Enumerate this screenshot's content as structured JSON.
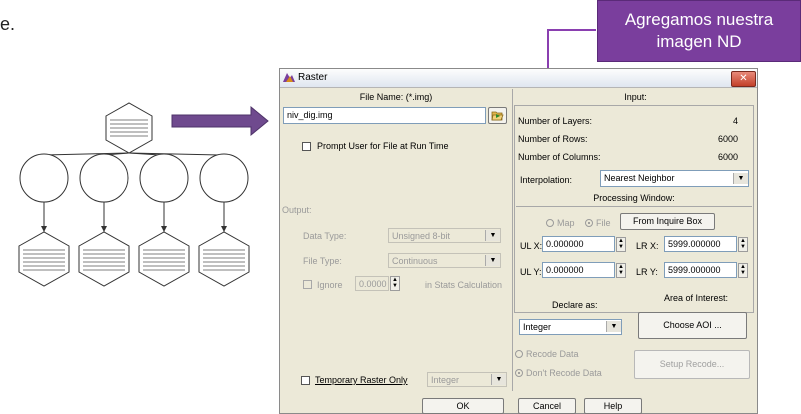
{
  "slide": {
    "fragment": "e.",
    "callout_line1": "Agregamos nuestra",
    "callout_line2": "imagen ND"
  },
  "colors": {
    "callout_purple": "#7a3e9d",
    "arrow_purple": "#6f4a8e",
    "connector_purple": "#8a3fb0",
    "dialog_bg": "#ece9d8",
    "close_red": "#c2402a"
  },
  "window": {
    "title": "Raster",
    "close_glyph": "✕"
  },
  "file": {
    "label": "File Name: (*.img)",
    "value": "niv_dig.img",
    "prompt_label": "Prompt User for File at Run Time"
  },
  "output": {
    "heading": "Output:",
    "data_type_label": "Data Type:",
    "data_type_value": "Unsigned 8-bit",
    "file_type_label": "File Type:",
    "file_type_value": "Continuous",
    "ignore_label": "Ignore",
    "ignore_value": "0.0000",
    "stats_label": "in Stats Calculation"
  },
  "input": {
    "heading": "Input:",
    "layers_label": "Number of Layers:",
    "layers_value": "4",
    "rows_label": "Number of Rows:",
    "rows_value": "6000",
    "cols_label": "Number of Columns:",
    "cols_value": "6000",
    "interp_label": "Interpolation:",
    "interp_value": "Nearest Neighbor"
  },
  "processing": {
    "heading": "Processing Window:",
    "map_label": "Map",
    "file_label": "File",
    "from_inquire": "From Inquire Box",
    "ulx_label": "UL X:",
    "ulx_value": "0.000000",
    "lrx_label": "LR X:",
    "lrx_value": "5999.000000",
    "uly_label": "UL Y:",
    "uly_value": "0.000000",
    "lry_label": "LR Y:",
    "lry_value": "5999.000000"
  },
  "declare": {
    "label": "Declare as:",
    "value": "Integer"
  },
  "aoi": {
    "label": "Area of Interest:",
    "button": "Choose AOI ..."
  },
  "recode": {
    "recode_label": "Recode Data",
    "dont_label": "Don't Recode Data",
    "setup_button": "Setup Recode..."
  },
  "temp": {
    "label": "Temporary Raster Only",
    "value": "Integer"
  },
  "buttons": {
    "ok": "OK",
    "cancel": "Cancel",
    "help": "Help"
  }
}
